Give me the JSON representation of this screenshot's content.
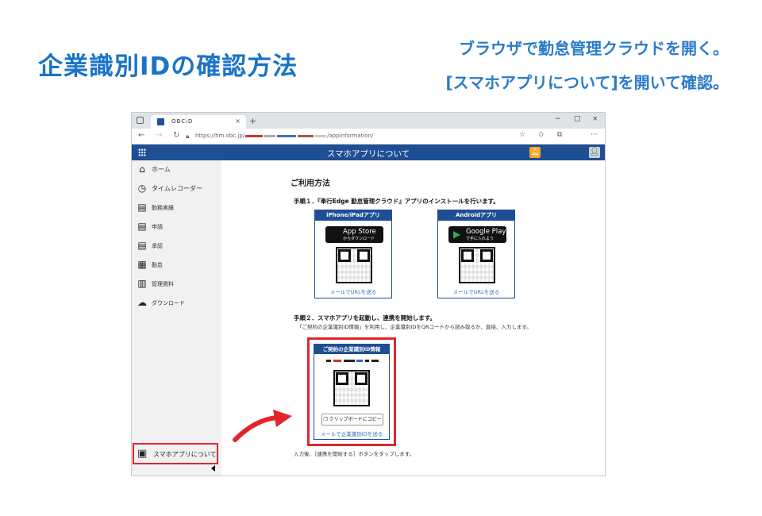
{
  "page": {
    "title": "企業識別IDの確認方法",
    "instructions": [
      "ブラウザで勤怠管理クラウドを開く。",
      "[スマホアプリについて]を開いて確認。"
    ]
  },
  "browser": {
    "tab_title": "OBCiD",
    "tab_close": "×",
    "new_tab": "+",
    "url_prefix": "https://hm.obc.jp/",
    "url_suffix": "/appinformation/",
    "window_controls": [
      "−",
      "□",
      "×"
    ],
    "more": "···"
  },
  "app": {
    "header_title": "スマホアプリについて",
    "sidebar": [
      {
        "label": "ホーム",
        "icon": "home-icon",
        "glyph": "⌂"
      },
      {
        "label": "タイムレコーダー",
        "icon": "clock-icon",
        "glyph": "◷"
      },
      {
        "label": "勤務実績",
        "icon": "document-icon",
        "glyph": "▤"
      },
      {
        "label": "申請",
        "icon": "request-icon",
        "glyph": "▤"
      },
      {
        "label": "承認",
        "icon": "approve-icon",
        "glyph": "▤"
      },
      {
        "label": "勤怠",
        "icon": "calendar-icon",
        "glyph": "▦"
      },
      {
        "label": "管理資料",
        "icon": "books-icon",
        "glyph": "▥"
      },
      {
        "label": "ダウンロード",
        "icon": "cloud-download-icon",
        "glyph": "☁"
      }
    ],
    "sidebar_bottom": "スマホアプリについて"
  },
  "content": {
    "heading": "ご利用方法",
    "step1": "手順１．『奉行Edge 勤怠管理クラウド』アプリのインストールを行います。",
    "ios": {
      "header": "iPhone/iPadアプリ",
      "badge_main": "App Store",
      "badge_sub": "からダウンロード",
      "link": "メールでURLを送る"
    },
    "android": {
      "header": "Androidアプリ",
      "badge_main": "Google Play",
      "badge_sub": "で手に入れよう",
      "link": "メールでURLを送る"
    },
    "step2": "手順２．スマホアプリを起動し、連携を開始します。",
    "step2_desc": "「ご契約の企業識別ID情報」を利用し、企業識別IDをQRコードから読み取るか、直接、入力します。",
    "id_box": {
      "header": "ご契約の企業識別ID情報",
      "copy_button": "クリップボードにコピー",
      "link": "メールで企業識別IDを送る"
    },
    "after": "入力後、［連携を開始する］ボタンをタップします。"
  },
  "colors": {
    "accent": "#1a73c8",
    "app_header": "#1e4e94",
    "highlight": "#e0262b"
  }
}
